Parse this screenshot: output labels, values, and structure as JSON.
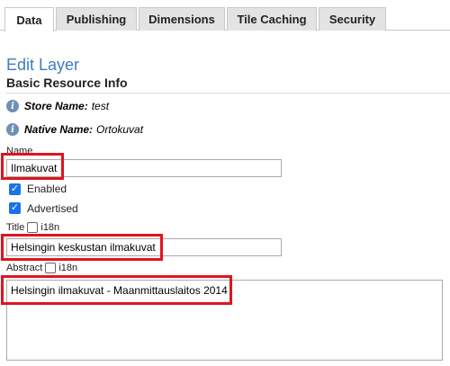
{
  "tabs": [
    "Data",
    "Publishing",
    "Dimensions",
    "Tile Caching",
    "Security"
  ],
  "heading": "Edit Layer",
  "subheading": "Basic Resource Info",
  "store": {
    "label": "Store Name:",
    "value": "test"
  },
  "native": {
    "label": "Native Name:",
    "value": "Ortokuvat"
  },
  "name": {
    "label": "Name",
    "value": "Ilmakuvat"
  },
  "enabled": {
    "label": "Enabled",
    "checked": true
  },
  "advertised": {
    "label": "Advertised",
    "checked": true
  },
  "title": {
    "label": "Title",
    "i18n": "i18n",
    "value": "Helsingin keskustan ilmakuvat"
  },
  "abstract": {
    "label": "Abstract",
    "i18n": "i18n",
    "value": "Helsingin ilmakuvat - Maanmittauslaitos 2014"
  },
  "colors": {
    "accent": "#3a7ec0",
    "highlight": "#e0141f",
    "checkbox": "#1a73e8"
  }
}
